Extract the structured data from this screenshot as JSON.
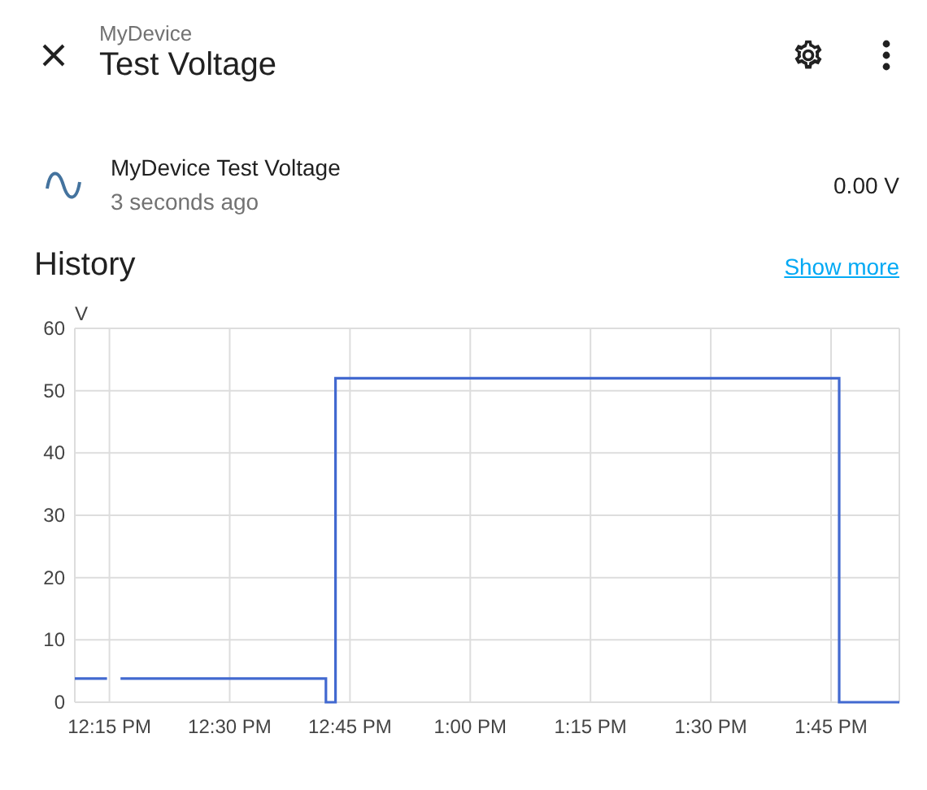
{
  "header": {
    "subtitle": "MyDevice",
    "title": "Test Voltage"
  },
  "entity": {
    "name": "MyDevice Test Voltage",
    "updated": "3 seconds ago",
    "state": "0.00 V"
  },
  "history": {
    "title": "History",
    "link": "Show more",
    "chart_data": {
      "type": "line",
      "grid": true,
      "ylabel": "V",
      "xlim": [
        12.178,
        13.892
      ],
      "ylim": [
        0,
        60
      ],
      "yticks": [
        0,
        10,
        20,
        30,
        40,
        50,
        60
      ],
      "xticks": [
        {
          "value": 12.25,
          "label": "12:15 PM"
        },
        {
          "value": 12.5,
          "label": "12:30 PM"
        },
        {
          "value": 12.75,
          "label": "12:45 PM"
        },
        {
          "value": 13,
          "label": "1:00 PM"
        },
        {
          "value": 13.25,
          "label": "1:15 PM"
        },
        {
          "value": 13.5,
          "label": "1:30 PM"
        },
        {
          "value": 13.75,
          "label": "1:45 PM"
        }
      ],
      "x": [
        12.178,
        12.245,
        12.247,
        12.273,
        12.7,
        12.7,
        12.72,
        12.72,
        13.767,
        13.767,
        13.892
      ],
      "series": [
        {
          "color": "#4269d0",
          "values": [
            3.8,
            3.8,
            null,
            3.8,
            3.8,
            0,
            0,
            52,
            52,
            0,
            0
          ]
        }
      ]
    }
  }
}
